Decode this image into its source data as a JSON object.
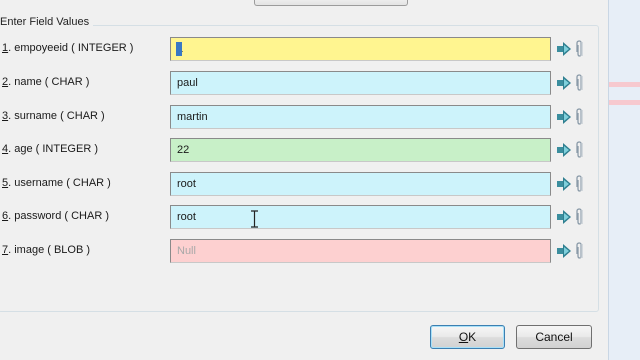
{
  "group_title": "Enter Field Values",
  "fields": [
    {
      "num": "1",
      "label": ". empoyeeid ( INTEGER )",
      "value": "1",
      "color": "#fff590"
    },
    {
      "num": "2",
      "label": ". name ( CHAR )",
      "value": "paul",
      "color": "#cdf3fb"
    },
    {
      "num": "3",
      "label": ". surname ( CHAR )",
      "value": "martin",
      "color": "#cdf3fb"
    },
    {
      "num": "4",
      "label": ". age ( INTEGER )",
      "value": "22",
      "color": "#c8f0c8"
    },
    {
      "num": "5",
      "label": ". username ( CHAR )",
      "value": "root",
      "color": "#cdf3fb"
    },
    {
      "num": "6",
      "label": ". password ( CHAR )",
      "value": "root",
      "color": "#cdf3fb"
    },
    {
      "num": "7",
      "label": ". image ( BLOB )",
      "value": "Null",
      "color": "#fdd0d0"
    }
  ],
  "icons": {
    "go": "arrow-right-icon",
    "attach": "paperclip-icon"
  },
  "buttons": {
    "ok_first": "O",
    "ok_rest": "K",
    "cancel": "Cancel"
  }
}
